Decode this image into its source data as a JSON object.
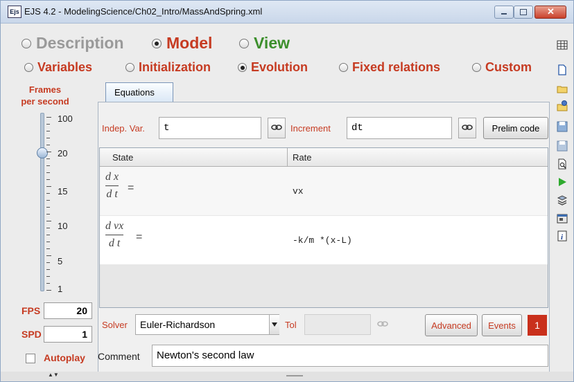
{
  "window": {
    "title": "EJS 4.2 - ModelingScience/Ch02_Intro/MassAndSpring.xml",
    "app_icon_label": "Ejs"
  },
  "main_tabs": [
    {
      "label": "Description",
      "selected": false,
      "color": "#9a9a9a"
    },
    {
      "label": "Model",
      "selected": true,
      "color": "#c63b22"
    },
    {
      "label": "View",
      "selected": false,
      "color": "#3c8f2c"
    }
  ],
  "model_tabs": [
    {
      "label": "Variables",
      "selected": false
    },
    {
      "label": "Initialization",
      "selected": false
    },
    {
      "label": "Evolution",
      "selected": true
    },
    {
      "label": "Fixed relations",
      "selected": false
    },
    {
      "label": "Custom",
      "selected": false
    }
  ],
  "speed": {
    "title_line1": "Frames",
    "title_line2": "per second",
    "tick_labels": [
      "100",
      "20",
      "15",
      "10",
      "5",
      "1"
    ],
    "slider_value": 20,
    "fps_label": "FPS",
    "fps_value": "20",
    "spd_label": "SPD",
    "spd_value": "1",
    "autoplay_label": "Autoplay",
    "autoplay_checked": false
  },
  "evolution": {
    "page_tab_label": "Equations",
    "indep_var_label": "Indep. Var.",
    "indep_var_value": "t",
    "increment_label": "Increment",
    "increment_value": "dt",
    "prelim_code_label": "Prelim code",
    "table_headers": {
      "state": "State",
      "rate": "Rate"
    },
    "equations": [
      {
        "numerator": "d x",
        "denominator": "d t",
        "equals": "=",
        "rate": "vx"
      },
      {
        "numerator": "d vx",
        "denominator": "d t",
        "equals": "=",
        "rate": "-k/m *(x-L)"
      }
    ],
    "solver_label": "Solver",
    "solver_value": "Euler-Richardson",
    "tol_label": "Tol",
    "tol_value": "",
    "advanced_label": "Advanced",
    "events_label": "Events",
    "events_count": "1",
    "comment_label": "Comment",
    "comment_value": "Newton's second law"
  },
  "toolbar_icons": [
    "table-icon",
    "new-file-icon",
    "open-folder-icon",
    "open-web-icon",
    "save-icon",
    "save-as-icon",
    "search-icon",
    "run-icon",
    "package-icon",
    "options-icon",
    "info-icon"
  ],
  "colors": {
    "accent_red": "#c63b22",
    "view_green": "#3c8f2c",
    "run_green": "#2eaa2e"
  }
}
